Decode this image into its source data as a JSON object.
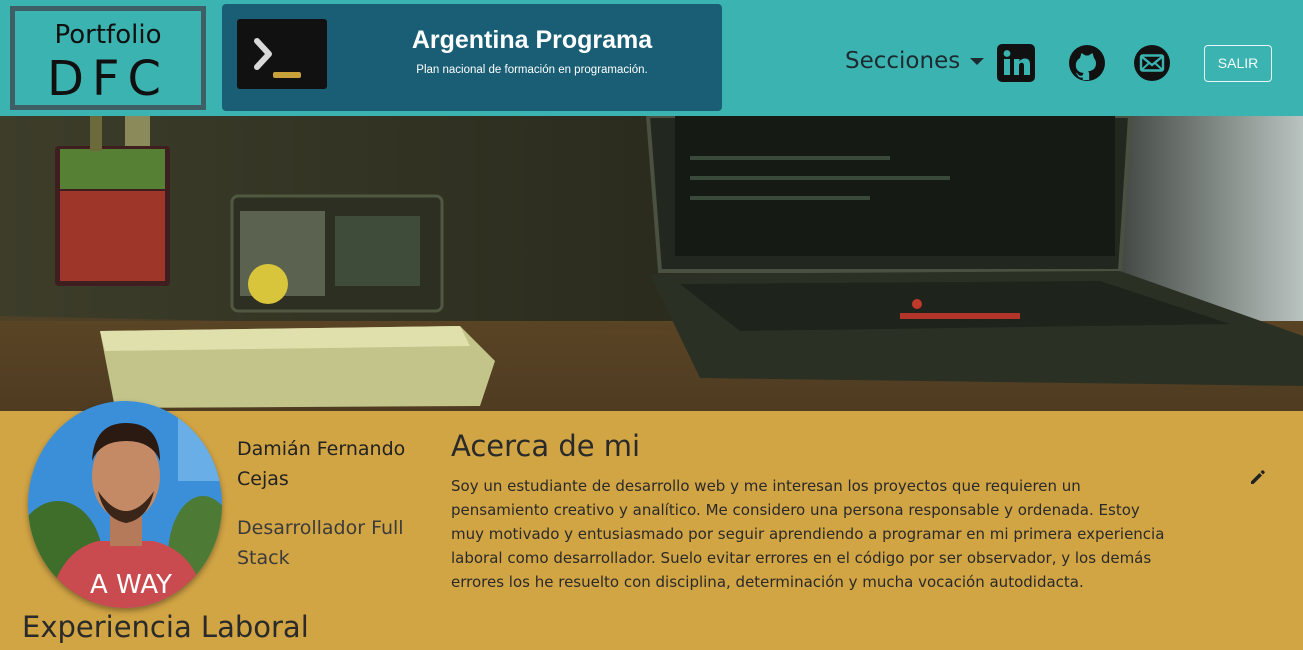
{
  "navbar": {
    "logo_top": "Portfolio",
    "logo_bottom": "DFC",
    "banner_title": "Argentina Programa",
    "banner_subtitle": "Plan nacional de formación en programación.",
    "sections_label": "Secciones",
    "social": [
      "linkedin-icon",
      "github-icon",
      "mail-icon"
    ],
    "logout_label": "SALIR"
  },
  "profile": {
    "first_names": "Damián Fernando",
    "last_name": "Cejas",
    "role": "Desarrollador Full Stack"
  },
  "about": {
    "title": "Acerca de mi",
    "text": "Soy un estudiante de desarrollo web y me interesan los proyectos que requieren un pensamiento creativo y analítico. Me considero una persona responsable y ordenada. Estoy muy motivado y entusiasmado por seguir aprendiendo a programar en mi primera experiencia laboral como desarrollador. Suelo evitar errores en el código por ser observador, y los demás errores los he resuelto con disciplina, determinación y mucha vocación autodidacta."
  },
  "sections": {
    "experience_title": "Experiencia Laboral"
  },
  "colors": {
    "navbar": "#3bb4b1",
    "banner": "#195e74",
    "page_background": "#d1a444",
    "logo_border": "#3e5f66"
  }
}
